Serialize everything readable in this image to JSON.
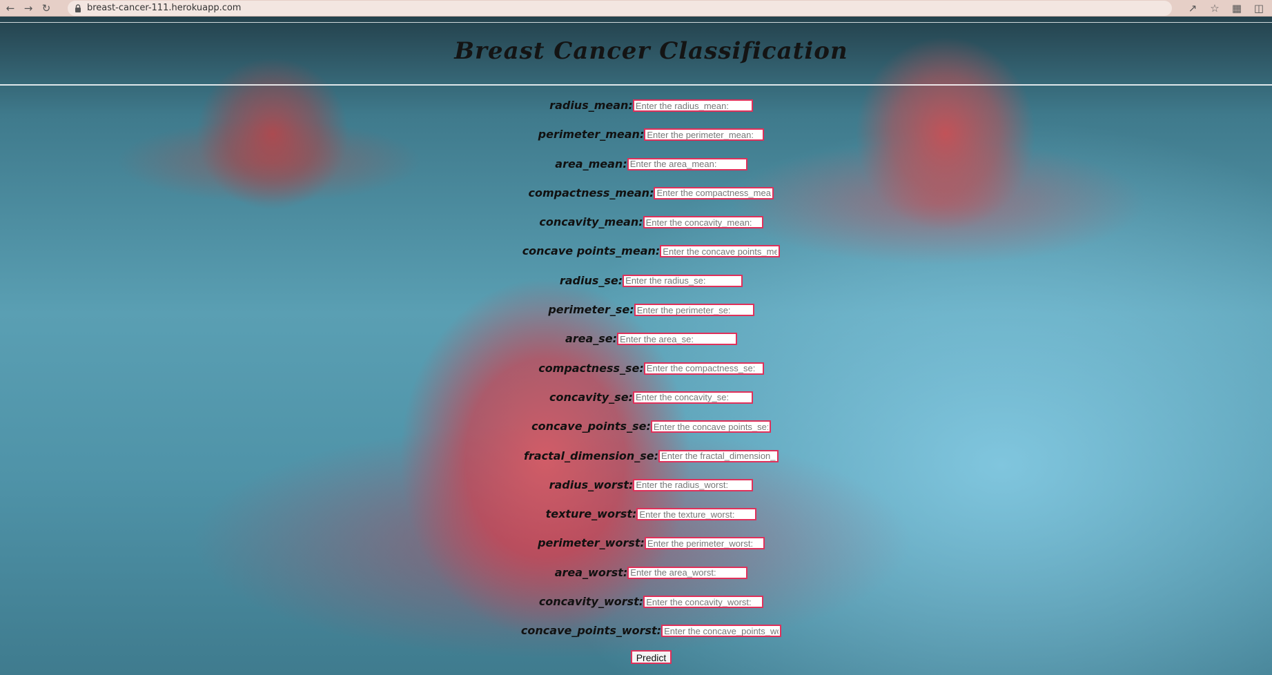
{
  "browser": {
    "back_icon": "back-arrow-icon",
    "forward_icon": "forward-arrow-icon",
    "reload_icon": "reload-icon",
    "lock_icon": "lock-icon",
    "url": "breast-cancer-111.herokuapp.com",
    "share_icon": "share-icon",
    "star_icon": "star-icon",
    "extensions_icon": "puzzle-icon",
    "sidepanel_icon": "side-panel-icon"
  },
  "page": {
    "title": "Breast Cancer Classification",
    "accent_color": "#e0305a"
  },
  "form": {
    "fields": [
      {
        "label": "radius_mean:",
        "placeholder": "Enter the radius_mean:"
      },
      {
        "label": "perimeter_mean:",
        "placeholder": "Enter the perimeter_mean:"
      },
      {
        "label": "area_mean:",
        "placeholder": "Enter the area_mean:"
      },
      {
        "label": "compactness_mean:",
        "placeholder": "Enter the compactness_mean:"
      },
      {
        "label": "concavity_mean:",
        "placeholder": "Enter the concavity_mean:"
      },
      {
        "label": "concave points_mean:",
        "placeholder": "Enter the concave points_mean:"
      },
      {
        "label": "radius_se:",
        "placeholder": "Enter the radius_se:"
      },
      {
        "label": "perimeter_se:",
        "placeholder": "Enter the perimeter_se:"
      },
      {
        "label": "area_se:",
        "placeholder": "Enter the area_se:"
      },
      {
        "label": "compactness_se:",
        "placeholder": "Enter the compactness_se:"
      },
      {
        "label": "concavity_se:",
        "placeholder": "Enter the concavity_se:"
      },
      {
        "label": "concave_points_se:",
        "placeholder": "Enter the concave points_se:"
      },
      {
        "label": "fractal_dimension_se:",
        "placeholder": "Enter the fractal_dimension_se:"
      },
      {
        "label": "radius_worst:",
        "placeholder": "Enter the radius_worst:"
      },
      {
        "label": "texture_worst:",
        "placeholder": "Enter the texture_worst:"
      },
      {
        "label": "perimeter_worst:",
        "placeholder": "Enter the perimeter_worst:"
      },
      {
        "label": "area_worst:",
        "placeholder": "Enter the area_worst:"
      },
      {
        "label": "concavity_worst:",
        "placeholder": "Enter the concavity_worst:"
      },
      {
        "label": "concave_points_worst:",
        "placeholder": "Enter the concave_points_worst:"
      }
    ],
    "submit_label": "Predict"
  }
}
